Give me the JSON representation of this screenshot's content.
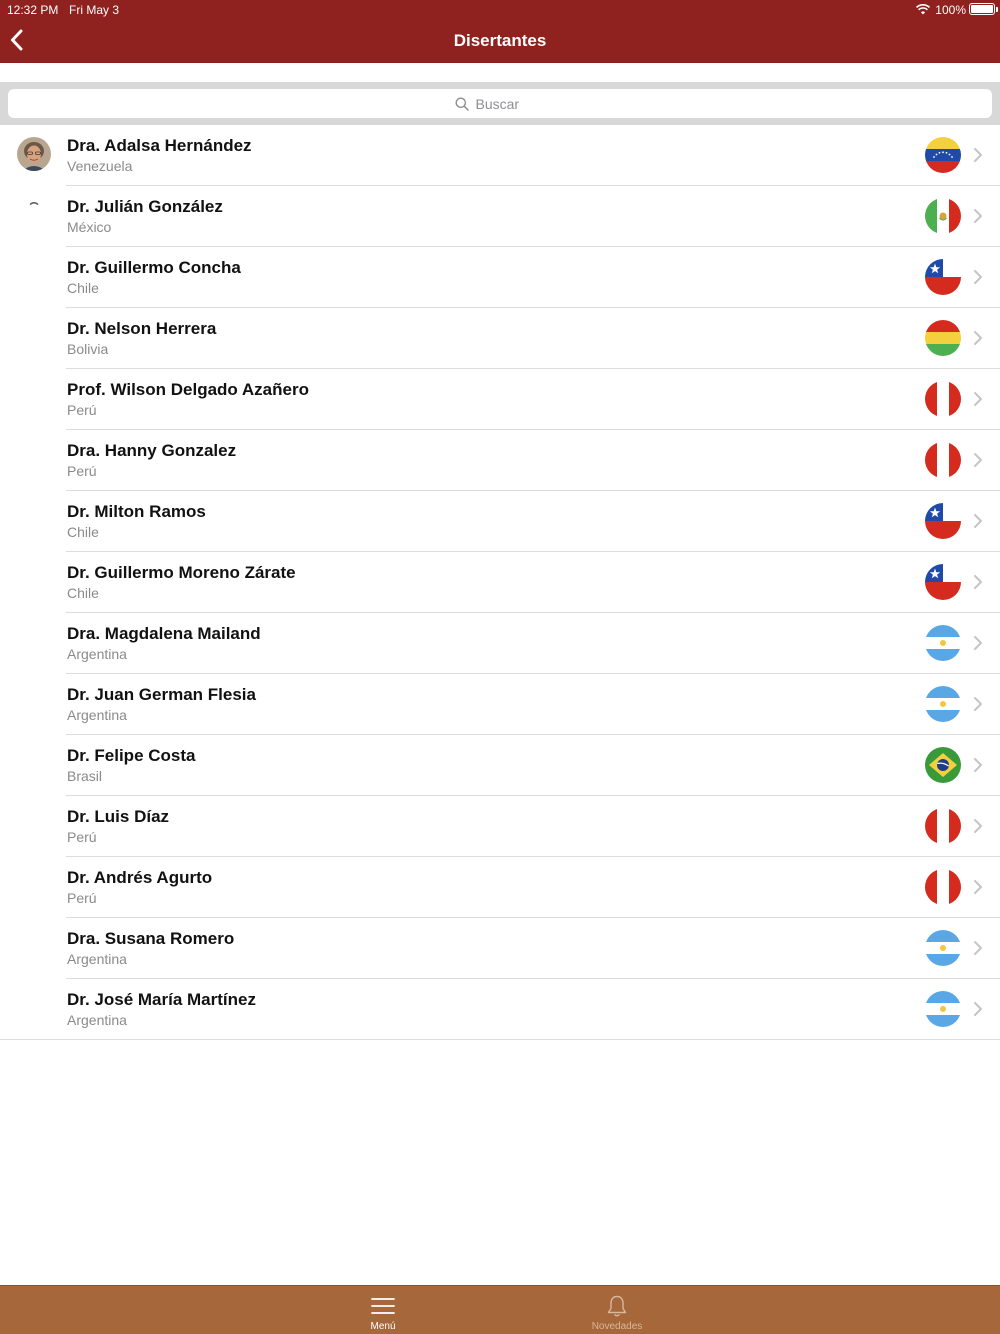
{
  "status_bar": {
    "time": "12:32 PM",
    "date": "Fri May 3",
    "battery": "100%"
  },
  "nav": {
    "title": "Disertantes",
    "back_icon": "chevron-left-icon"
  },
  "search": {
    "placeholder": "Buscar",
    "icon": "search-icon"
  },
  "speakers": [
    {
      "name": "Dra. Adalsa Hernández",
      "country": "Venezuela",
      "flag": "venezuela"
    },
    {
      "name": "Dr. Julián González",
      "country": "México",
      "flag": "mexico"
    },
    {
      "name": "Dr. Guillermo Concha",
      "country": "Chile",
      "flag": "chile"
    },
    {
      "name": "Dr. Nelson Herrera",
      "country": "Bolivia",
      "flag": "bolivia"
    },
    {
      "name": "Prof. Wilson Delgado Azañero",
      "country": "Perú",
      "flag": "peru"
    },
    {
      "name": "Dra. Hanny Gonzalez",
      "country": "Perú",
      "flag": "peru"
    },
    {
      "name": "Dr. Milton Ramos",
      "country": "Chile",
      "flag": "chile"
    },
    {
      "name": "Dr. Guillermo Moreno Zárate",
      "country": "Chile",
      "flag": "chile"
    },
    {
      "name": "Dra. Magdalena Mailand",
      "country": "Argentina",
      "flag": "argentina"
    },
    {
      "name": "Dr. Juan German Flesia",
      "country": "Argentina",
      "flag": "argentina"
    },
    {
      "name": "Dr. Felipe Costa",
      "country": "Brasil",
      "flag": "brasil"
    },
    {
      "name": "Dr. Luis Díaz",
      "country": "Perú",
      "flag": "peru"
    },
    {
      "name": "Dr. Andrés Agurto",
      "country": "Perú",
      "flag": "peru"
    },
    {
      "name": "Dra. Susana Romero",
      "country": "Argentina",
      "flag": "argentina"
    },
    {
      "name": "Dr. José María Martínez",
      "country": "Argentina",
      "flag": "argentina"
    }
  ],
  "tabbar": {
    "menu_label": "Menú",
    "news_label": "Novedades",
    "menu_icon": "hamburger-menu-icon",
    "news_icon": "bell-icon"
  },
  "colors": {
    "nav_background": "#8f211e",
    "tabbar_background": "#a6673a",
    "tab_active": "#ffffff",
    "tab_inactive": "#d9b79d",
    "country_text": "#8a8a8a"
  }
}
